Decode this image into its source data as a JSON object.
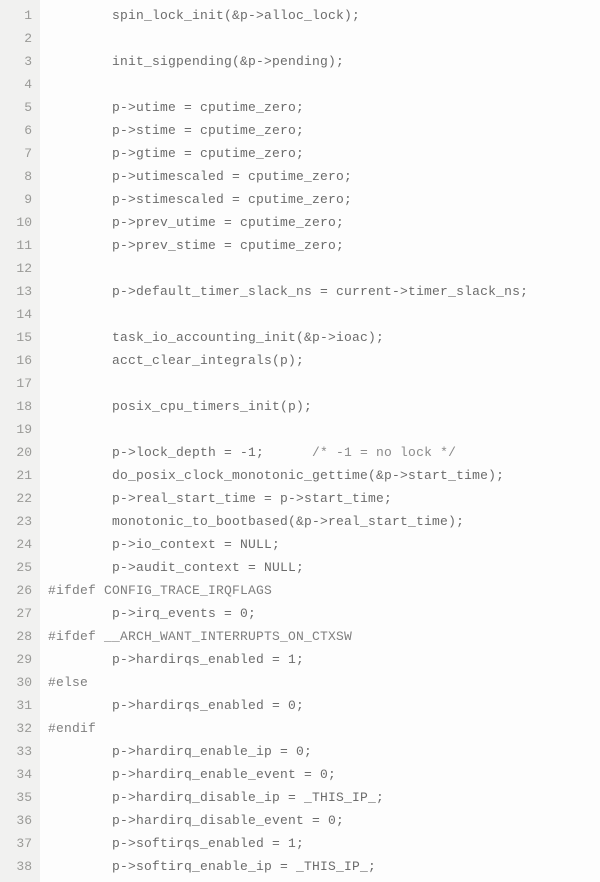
{
  "code": {
    "start_line": 1,
    "lines": [
      {
        "html": "        spin_lock_init(&amp;p-&gt;alloc_lock);"
      },
      {
        "html": ""
      },
      {
        "html": "        init_sigpending(&amp;p-&gt;pending);"
      },
      {
        "html": ""
      },
      {
        "html": "        p-&gt;utime = cputime_zero;"
      },
      {
        "html": "        p-&gt;stime = cputime_zero;"
      },
      {
        "html": "        p-&gt;gtime = cputime_zero;"
      },
      {
        "html": "        p-&gt;utimescaled = cputime_zero;"
      },
      {
        "html": "        p-&gt;stimescaled = cputime_zero;"
      },
      {
        "html": "        p-&gt;prev_utime = cputime_zero;"
      },
      {
        "html": "        p-&gt;prev_stime = cputime_zero;"
      },
      {
        "html": ""
      },
      {
        "html": "        p-&gt;default_timer_slack_ns = current-&gt;timer_slack_ns;"
      },
      {
        "html": ""
      },
      {
        "html": "        task_io_accounting_init(&amp;p-&gt;ioac);"
      },
      {
        "html": "        acct_clear_integrals(p);"
      },
      {
        "html": ""
      },
      {
        "html": "        posix_cpu_timers_init(p);"
      },
      {
        "html": ""
      },
      {
        "html": "        p-&gt;lock_depth = -1;      <span class=\"comment\">/* -1 = no lock */</span>"
      },
      {
        "html": "        do_posix_clock_monotonic_gettime(&amp;p-&gt;start_time);"
      },
      {
        "html": "        p-&gt;real_start_time = p-&gt;start_time;"
      },
      {
        "html": "        monotonic_to_bootbased(&amp;p-&gt;real_start_time);"
      },
      {
        "html": "        p-&gt;io_context = NULL;"
      },
      {
        "html": "        p-&gt;audit_context = NULL;"
      },
      {
        "html": "<span class=\"preproc\">#ifdef CONFIG_TRACE_IRQFLAGS</span>"
      },
      {
        "html": "        p-&gt;irq_events = 0;"
      },
      {
        "html": "<span class=\"preproc\">#ifdef __ARCH_WANT_INTERRUPTS_ON_CTXSW</span>"
      },
      {
        "html": "        p-&gt;hardirqs_enabled = 1;"
      },
      {
        "html": "<span class=\"preproc\">#else</span>"
      },
      {
        "html": "        p-&gt;hardirqs_enabled = 0;"
      },
      {
        "html": "<span class=\"preproc\">#endif</span>"
      },
      {
        "html": "        p-&gt;hardirq_enable_ip = 0;"
      },
      {
        "html": "        p-&gt;hardirq_enable_event = 0;"
      },
      {
        "html": "        p-&gt;hardirq_disable_ip = _THIS_IP_;"
      },
      {
        "html": "        p-&gt;hardirq_disable_event = 0;"
      },
      {
        "html": "        p-&gt;softirqs_enabled = 1;"
      },
      {
        "html": "        p-&gt;softirq_enable_ip = _THIS_IP_;"
      }
    ]
  }
}
